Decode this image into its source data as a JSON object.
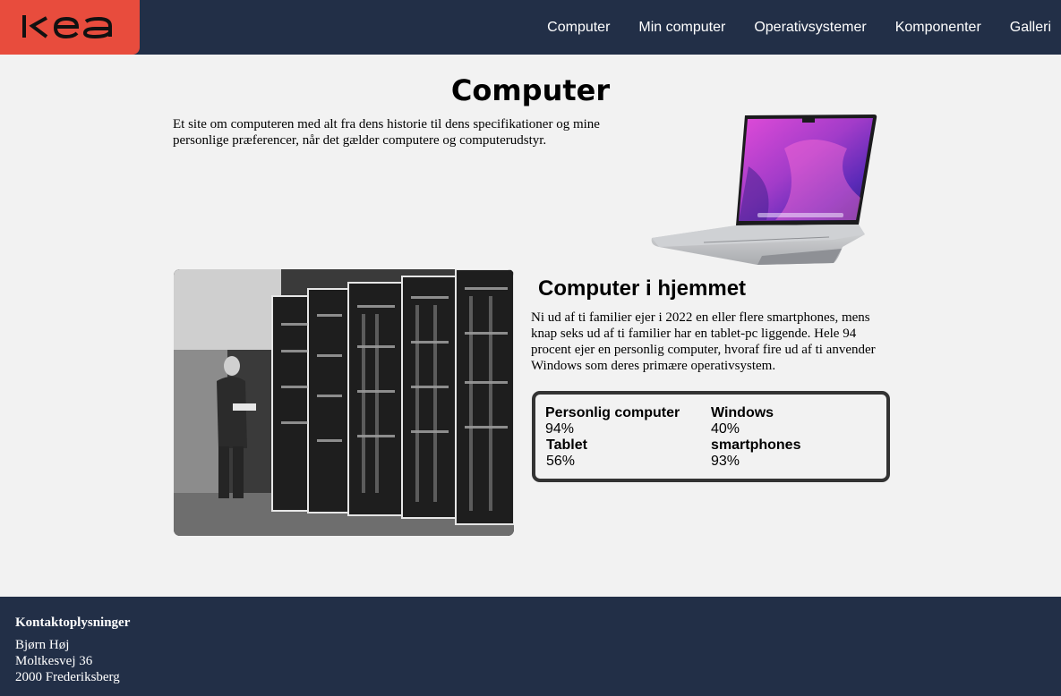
{
  "brand": {
    "logo_text": "kea",
    "accent": "#e84c3d",
    "dark": "#222f47"
  },
  "nav": {
    "items": [
      "Computer",
      "Min computer",
      "Operativsystemer",
      "Komponenter",
      "Galleri"
    ]
  },
  "hero": {
    "title": "Computer",
    "intro": "Et site om computeren med alt fra dens historie til dens specifikationer og mine personlige præferencer, når det gælder computere og computerudstyr."
  },
  "section": {
    "title": "Computer i hjemmet",
    "text": "Ni ud af ti familier ejer i 2022 en eller flere smartphones, mens knap seks ud af ti familier har en tablet-pc liggende. Hele 94 procent ejer en personlig computer, hvoraf fire ud af ti anvender Windows som deres primære operativsystem."
  },
  "stats": [
    {
      "label": "Personlig computer",
      "value": "94%"
    },
    {
      "label": "Windows",
      "value": "40%"
    },
    {
      "label": "Tablet",
      "value": "56%"
    },
    {
      "label": "smartphones",
      "value": "93%"
    }
  ],
  "footer": {
    "heading": "Kontaktoplysninger",
    "name": "Bjørn Høj",
    "street": "Moltkesvej 36",
    "city": "2000 Frederiksberg"
  }
}
